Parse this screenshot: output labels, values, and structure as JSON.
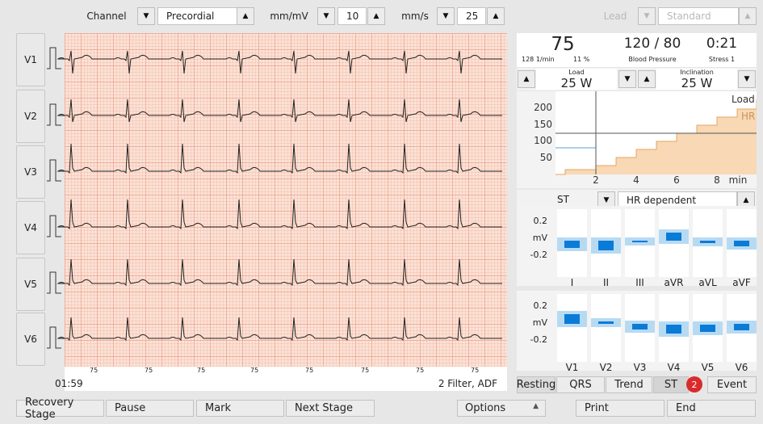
{
  "toolbar": {
    "channel_label": "Channel",
    "channel_value": "Precordial",
    "gain_label": "mm/mV",
    "gain_value": "10",
    "speed_label": "mm/s",
    "speed_value": "25",
    "lead_label": "Lead",
    "lead_value": "Standard"
  },
  "leads": [
    "V1",
    "V2",
    "V3",
    "V4",
    "V5",
    "V6"
  ],
  "ecg": {
    "time": "01:59",
    "filter": "2 Filter, ADF",
    "rr_labels": [
      "75",
      "75",
      "75",
      "75",
      "75",
      "75",
      "75",
      "75"
    ]
  },
  "vitals": {
    "hr": "75",
    "hr_unit": "128 1/min",
    "pct": "11 %",
    "bp": "120 / 80",
    "bp_label": "Blood Pressure",
    "time": "0:21",
    "stage": "Stress 1"
  },
  "load": {
    "label": "Load",
    "value": "25 W",
    "incl_label": "Inclination",
    "incl_value": "25 W"
  },
  "trend": {
    "y_ticks": [
      "200",
      "150",
      "100",
      "50"
    ],
    "x_ticks": [
      "2",
      "4",
      "6",
      "8"
    ],
    "x_unit": "min",
    "load_legend": "Load",
    "hr_legend": "HR"
  },
  "st": {
    "label": "ST",
    "mode": "HR dependent",
    "ticks": [
      "0.2",
      "mV",
      "-0.2"
    ],
    "limb_leads": [
      "I",
      "II",
      "III",
      "aVR",
      "aVL",
      "aVF"
    ],
    "chest_leads": [
      "V1",
      "V2",
      "V3",
      "V4",
      "V5",
      "V6"
    ]
  },
  "tabs": {
    "resting": "Resting",
    "qrs": "QRS",
    "trend": "Trend",
    "st": "ST",
    "st_badge": "2",
    "event": "Event"
  },
  "buttons": {
    "recovery": "Recovery Stage",
    "pause": "Pause",
    "mark": "Mark",
    "next": "Next Stage",
    "options": "Options",
    "print": "Print",
    "end": "End"
  },
  "colors": {
    "grid": "#fbe2d6",
    "load_fill": "#f8d8b5",
    "load_line": "#e9a561",
    "st_bar": "#0a7bd6",
    "st_band": "#b7daf3",
    "badge": "#d92b2b"
  }
}
